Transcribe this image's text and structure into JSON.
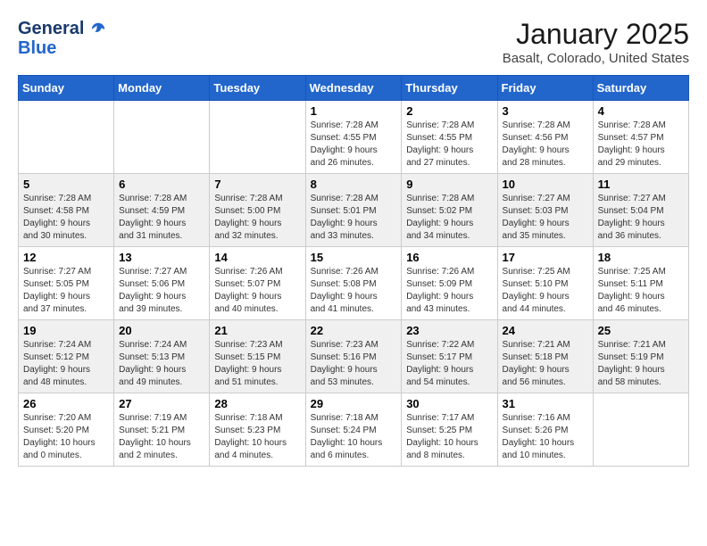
{
  "logo": {
    "line1": "General",
    "line2": "Blue"
  },
  "title": "January 2025",
  "location": "Basalt, Colorado, United States",
  "weekdays": [
    "Sunday",
    "Monday",
    "Tuesday",
    "Wednesday",
    "Thursday",
    "Friday",
    "Saturday"
  ],
  "weeks": [
    [
      {
        "day": "",
        "info": ""
      },
      {
        "day": "",
        "info": ""
      },
      {
        "day": "",
        "info": ""
      },
      {
        "day": "1",
        "info": "Sunrise: 7:28 AM\nSunset: 4:55 PM\nDaylight: 9 hours\nand 26 minutes."
      },
      {
        "day": "2",
        "info": "Sunrise: 7:28 AM\nSunset: 4:55 PM\nDaylight: 9 hours\nand 27 minutes."
      },
      {
        "day": "3",
        "info": "Sunrise: 7:28 AM\nSunset: 4:56 PM\nDaylight: 9 hours\nand 28 minutes."
      },
      {
        "day": "4",
        "info": "Sunrise: 7:28 AM\nSunset: 4:57 PM\nDaylight: 9 hours\nand 29 minutes."
      }
    ],
    [
      {
        "day": "5",
        "info": "Sunrise: 7:28 AM\nSunset: 4:58 PM\nDaylight: 9 hours\nand 30 minutes."
      },
      {
        "day": "6",
        "info": "Sunrise: 7:28 AM\nSunset: 4:59 PM\nDaylight: 9 hours\nand 31 minutes."
      },
      {
        "day": "7",
        "info": "Sunrise: 7:28 AM\nSunset: 5:00 PM\nDaylight: 9 hours\nand 32 minutes."
      },
      {
        "day": "8",
        "info": "Sunrise: 7:28 AM\nSunset: 5:01 PM\nDaylight: 9 hours\nand 33 minutes."
      },
      {
        "day": "9",
        "info": "Sunrise: 7:28 AM\nSunset: 5:02 PM\nDaylight: 9 hours\nand 34 minutes."
      },
      {
        "day": "10",
        "info": "Sunrise: 7:27 AM\nSunset: 5:03 PM\nDaylight: 9 hours\nand 35 minutes."
      },
      {
        "day": "11",
        "info": "Sunrise: 7:27 AM\nSunset: 5:04 PM\nDaylight: 9 hours\nand 36 minutes."
      }
    ],
    [
      {
        "day": "12",
        "info": "Sunrise: 7:27 AM\nSunset: 5:05 PM\nDaylight: 9 hours\nand 37 minutes."
      },
      {
        "day": "13",
        "info": "Sunrise: 7:27 AM\nSunset: 5:06 PM\nDaylight: 9 hours\nand 39 minutes."
      },
      {
        "day": "14",
        "info": "Sunrise: 7:26 AM\nSunset: 5:07 PM\nDaylight: 9 hours\nand 40 minutes."
      },
      {
        "day": "15",
        "info": "Sunrise: 7:26 AM\nSunset: 5:08 PM\nDaylight: 9 hours\nand 41 minutes."
      },
      {
        "day": "16",
        "info": "Sunrise: 7:26 AM\nSunset: 5:09 PM\nDaylight: 9 hours\nand 43 minutes."
      },
      {
        "day": "17",
        "info": "Sunrise: 7:25 AM\nSunset: 5:10 PM\nDaylight: 9 hours\nand 44 minutes."
      },
      {
        "day": "18",
        "info": "Sunrise: 7:25 AM\nSunset: 5:11 PM\nDaylight: 9 hours\nand 46 minutes."
      }
    ],
    [
      {
        "day": "19",
        "info": "Sunrise: 7:24 AM\nSunset: 5:12 PM\nDaylight: 9 hours\nand 48 minutes."
      },
      {
        "day": "20",
        "info": "Sunrise: 7:24 AM\nSunset: 5:13 PM\nDaylight: 9 hours\nand 49 minutes."
      },
      {
        "day": "21",
        "info": "Sunrise: 7:23 AM\nSunset: 5:15 PM\nDaylight: 9 hours\nand 51 minutes."
      },
      {
        "day": "22",
        "info": "Sunrise: 7:23 AM\nSunset: 5:16 PM\nDaylight: 9 hours\nand 53 minutes."
      },
      {
        "day": "23",
        "info": "Sunrise: 7:22 AM\nSunset: 5:17 PM\nDaylight: 9 hours\nand 54 minutes."
      },
      {
        "day": "24",
        "info": "Sunrise: 7:21 AM\nSunset: 5:18 PM\nDaylight: 9 hours\nand 56 minutes."
      },
      {
        "day": "25",
        "info": "Sunrise: 7:21 AM\nSunset: 5:19 PM\nDaylight: 9 hours\nand 58 minutes."
      }
    ],
    [
      {
        "day": "26",
        "info": "Sunrise: 7:20 AM\nSunset: 5:20 PM\nDaylight: 10 hours\nand 0 minutes."
      },
      {
        "day": "27",
        "info": "Sunrise: 7:19 AM\nSunset: 5:21 PM\nDaylight: 10 hours\nand 2 minutes."
      },
      {
        "day": "28",
        "info": "Sunrise: 7:18 AM\nSunset: 5:23 PM\nDaylight: 10 hours\nand 4 minutes."
      },
      {
        "day": "29",
        "info": "Sunrise: 7:18 AM\nSunset: 5:24 PM\nDaylight: 10 hours\nand 6 minutes."
      },
      {
        "day": "30",
        "info": "Sunrise: 7:17 AM\nSunset: 5:25 PM\nDaylight: 10 hours\nand 8 minutes."
      },
      {
        "day": "31",
        "info": "Sunrise: 7:16 AM\nSunset: 5:26 PM\nDaylight: 10 hours\nand 10 minutes."
      },
      {
        "day": "",
        "info": ""
      }
    ]
  ]
}
